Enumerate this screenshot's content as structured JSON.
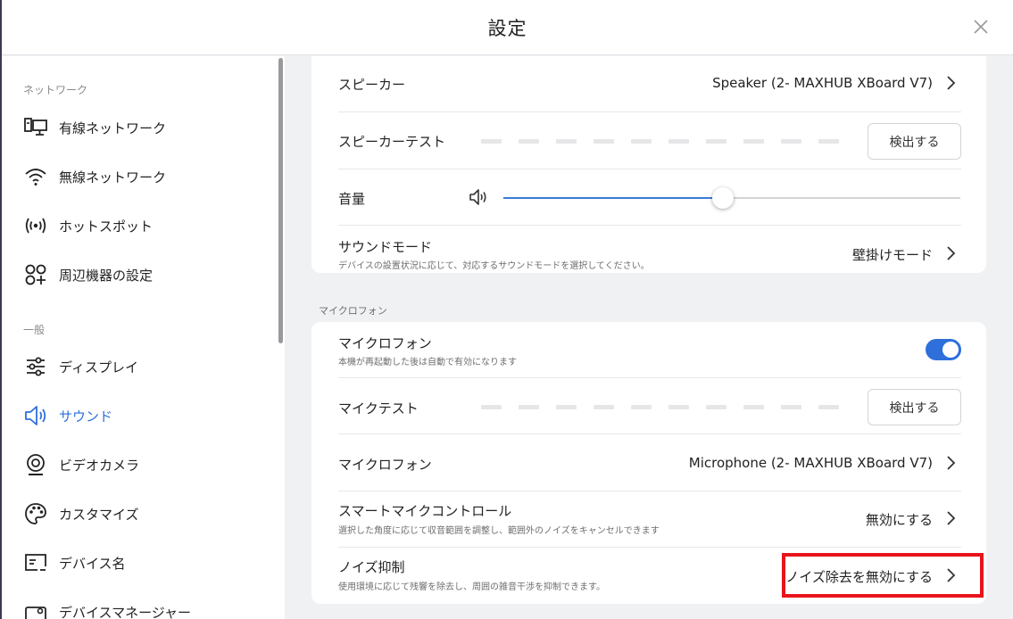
{
  "window": {
    "title": "設定"
  },
  "sidebar": {
    "sections": [
      {
        "label": "ネットワーク"
      },
      {
        "label": "一般"
      }
    ],
    "items": [
      {
        "label": "有線ネットワーク",
        "icon": "wired-network-icon"
      },
      {
        "label": "無線ネットワーク",
        "icon": "wifi-icon"
      },
      {
        "label": "ホットスポット",
        "icon": "hotspot-icon"
      },
      {
        "label": "周辺機器の設定",
        "icon": "peripherals-icon"
      },
      {
        "label": "ディスプレイ",
        "icon": "display-sliders-icon"
      },
      {
        "label": "サウンド",
        "icon": "speaker-icon",
        "active": true
      },
      {
        "label": "ビデオカメラ",
        "icon": "camera-icon"
      },
      {
        "label": "カスタマイズ",
        "icon": "palette-icon"
      },
      {
        "label": "デバイス名",
        "icon": "device-name-icon"
      },
      {
        "label": "デバイスマネージャー",
        "icon": "device-manager-icon"
      }
    ]
  },
  "speaker_card": {
    "speaker": {
      "title": "スピーカー",
      "value": "Speaker (2- MAXHUB XBoard V7)"
    },
    "speaker_test": {
      "title": "スピーカーテスト",
      "button": "検出する"
    },
    "volume": {
      "title": "音量",
      "level": 0.48
    },
    "sound_mode": {
      "title": "サウンドモード",
      "desc": "デバイスの設置状況に応じて、対応するサウンドモードを選択してください。",
      "value": "壁掛けモード"
    }
  },
  "mic_group_label": "マイクロフォン",
  "mic_card": {
    "microphone_toggle": {
      "title": "マイクロフォン",
      "desc": "本機が再起動した後は自動で有効になります",
      "enabled": true
    },
    "mic_test": {
      "title": "マイクテスト",
      "button": "検出する"
    },
    "microphone_device": {
      "title": "マイクロフォン",
      "value": "Microphone (2- MAXHUB XBoard V7)"
    },
    "smart_mic": {
      "title": "スマートマイクコントロール",
      "desc": "選択した角度に応じて収音範囲を調整し、範囲外のノイズをキャンセルできます",
      "value": "無効にする"
    },
    "noise_suppression": {
      "title": "ノイズ抑制",
      "desc": "使用環境に応じて残響を除去し、周囲の雑音干渉を抑制できます。",
      "value": "ノイズ除去を無効にする"
    }
  },
  "colors": {
    "accent": "#2e6fdb",
    "highlight": "#e8141c"
  }
}
